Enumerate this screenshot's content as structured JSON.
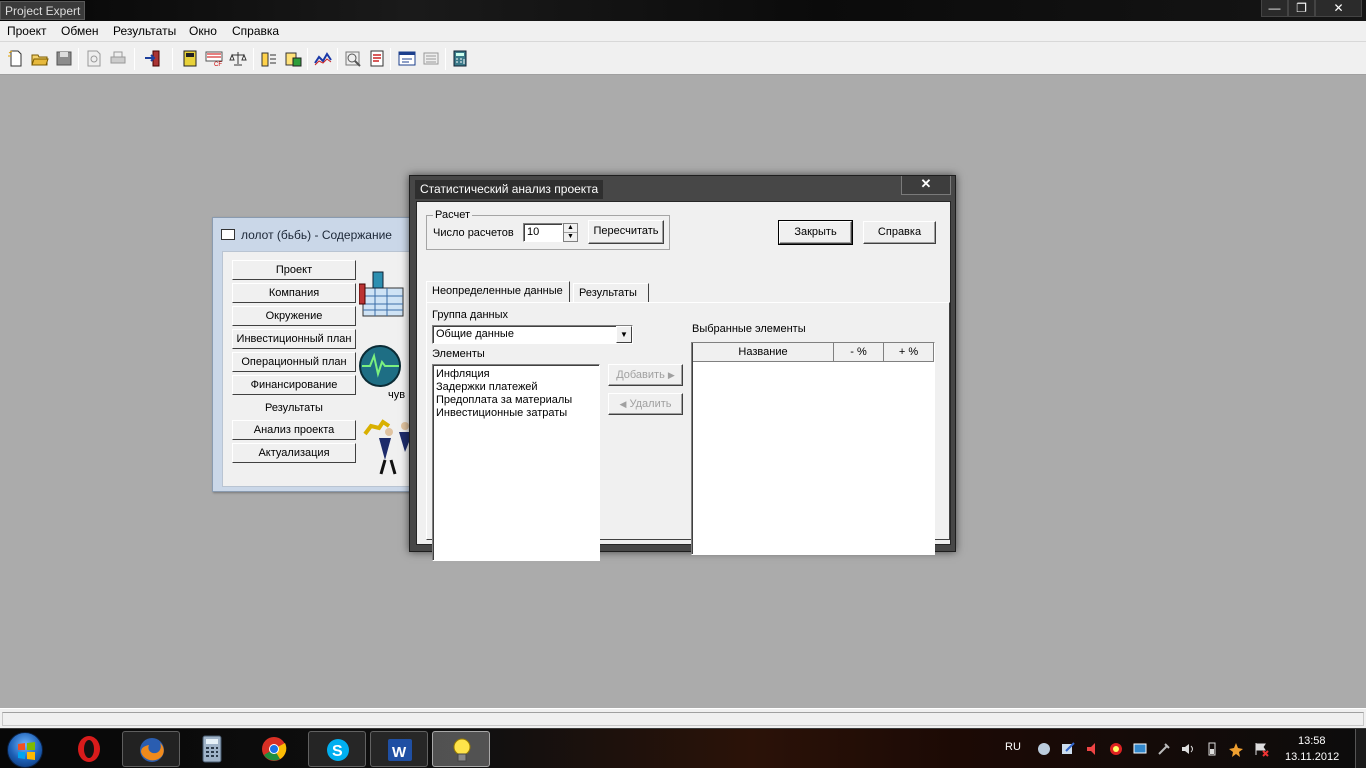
{
  "window": {
    "title": "Project Expert",
    "controls": {
      "minimize": "—",
      "maximize": "❐",
      "close": "✕"
    }
  },
  "menu": [
    "Проект",
    "Обмен",
    "Результаты",
    "Окно",
    "Справка"
  ],
  "toolbar": {
    "icons": [
      "new-document-icon",
      "open-folder-icon",
      "save-icon",
      "print-preview-icon",
      "print-icon",
      "exit-icon",
      "module-icon",
      "cash-flow-icon",
      "balance-icon",
      "table-icon",
      "chart-report-icon",
      "graph-icon",
      "analysis-icon",
      "report-icon",
      "window-icon",
      "list-icon",
      "calculator-icon"
    ]
  },
  "child_window": {
    "title": "лолот (бьбь) - Содержание",
    "buttons": [
      "Проект",
      "Компания",
      "Окружение",
      "Инвестиционный план",
      "Операционный план",
      "Финансирование",
      "Результаты",
      "Анализ проекта",
      "Актуализация"
    ],
    "partial_label": "чув"
  },
  "dialog": {
    "title": "Статистический анализ проекта",
    "close_glyph": "✕",
    "calc_group": {
      "label": "Расчет",
      "count_label": "Число расчетов",
      "count_value": "10",
      "recalc_button": "Пересчитать"
    },
    "close_button": "Закрыть",
    "help_button": "Справка",
    "tabs": [
      {
        "label": "Неопределенные данные",
        "active": true
      },
      {
        "label": "Результаты",
        "active": false
      }
    ],
    "data_group_label": "Группа данных",
    "data_group_value": "Общие данные",
    "elements_label": "Элементы",
    "elements": [
      "Инфляция",
      "Задержки платежей",
      "Предоплата за материалы",
      "Инвестиционные затраты"
    ],
    "add_button": "Добавить",
    "remove_button": "Удалить",
    "selected_label": "Выбранные элементы",
    "columns": [
      "Название",
      "- %",
      "+ %"
    ]
  },
  "taskbar": {
    "apps": [
      "opera-icon",
      "firefox-icon",
      "calculator-icon",
      "chrome-icon",
      "skype-icon",
      "word-icon",
      "project-expert-icon"
    ],
    "language": "RU",
    "time": "13:58",
    "date": "13.11.2012"
  },
  "colors": {
    "workspace": "#ababab",
    "dialog_frame": "#474747",
    "child_frame": "#cad7e8"
  }
}
